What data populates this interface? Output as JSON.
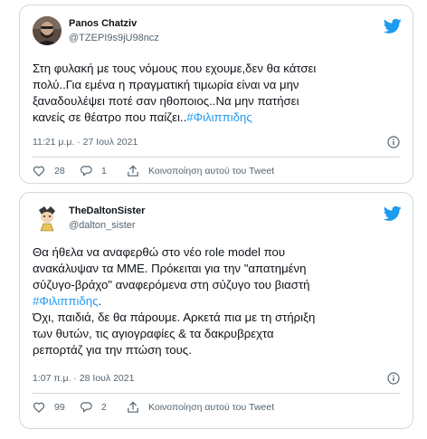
{
  "tweets": [
    {
      "author_name": "Panos Chatziv",
      "author_handle": "@TZEPI9s9jU98ncz",
      "text_lines": [
        "Στη φυλακή με τους νόμους που εχουμε,δεν θα κάτσει",
        "πολύ..Για εμένα η πραγματική τιμωρία είναι να μην",
        "ξαναδουλέψει ποτέ σαν ηθοποιος..Να μην πατήσει",
        "κανείς σε θέατρο που παίζει.."
      ],
      "hashtag": "#Φιλιππιδης",
      "timestamp": "11:21 μ.μ. · 27 Ιουλ 2021",
      "likes": "28",
      "replies": "1",
      "share_label": "Κοινοποίηση αυτού του Tweet",
      "icons": {
        "brand": "twitter-bird-icon",
        "info": "info-icon",
        "like": "heart-icon",
        "reply": "comment-bubble-icon",
        "share": "share-upload-icon"
      }
    },
    {
      "author_name": "TheDaltonSister",
      "author_handle": "@dalton_sister",
      "text_lines_a": [
        "Θα ήθελα να αναφερθώ στο νέο role model που",
        "ανακάλυψαν τα ΜΜΕ. Πρόκειται για την \"απατημένη",
        "σύζυγο-βράχο\" αναφερόμενα στη σύζυγο του βιαστή"
      ],
      "hashtag": "#Φιλιππιδης",
      "hashtag_suffix": ".",
      "text_lines_b": [
        "Όχι, παιδιά, δε θα πάρουμε. Αρκετά πια με τη στήριξη",
        "των θυτών, τις αγιογραφίες & τα δακρυβρεχτα",
        "ρεπορτάζ για την πτώση τους."
      ],
      "timestamp": "1:07 π.μ. · 28 Ιουλ 2021",
      "likes": "99",
      "replies": "2",
      "share_label": "Κοινοποίηση αυτού του Tweet",
      "icons": {
        "brand": "twitter-bird-icon",
        "info": "info-icon",
        "like": "heart-icon",
        "reply": "comment-bubble-icon",
        "share": "share-upload-icon"
      }
    }
  ],
  "colors": {
    "twitter_blue": "#1d9bf0",
    "text": "#0f1419",
    "muted": "#536471",
    "border": "#cfd9de"
  }
}
